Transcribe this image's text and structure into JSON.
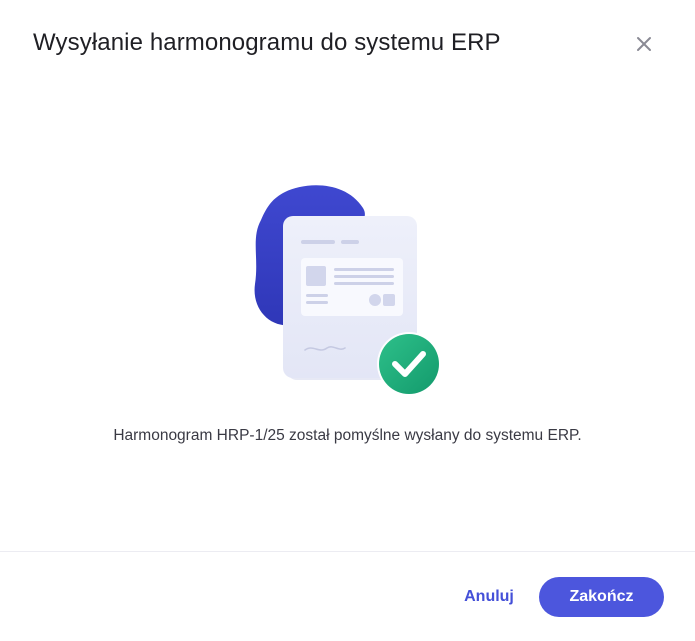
{
  "dialog": {
    "title": "Wysyłanie harmonogramu do systemu ERP",
    "close_icon": "close-icon",
    "message": "Harmonogram HRP-1/25 został pomyślne wysłany do systemu ERP.",
    "illustration_icon": "document-success-illustration"
  },
  "footer": {
    "cancel_label": "Anuluj",
    "finish_label": "Zakończ"
  },
  "colors": {
    "accent": "#4c56dd",
    "link": "#4450d8",
    "blob": "#3b43c9",
    "success": "#1fae7d"
  }
}
